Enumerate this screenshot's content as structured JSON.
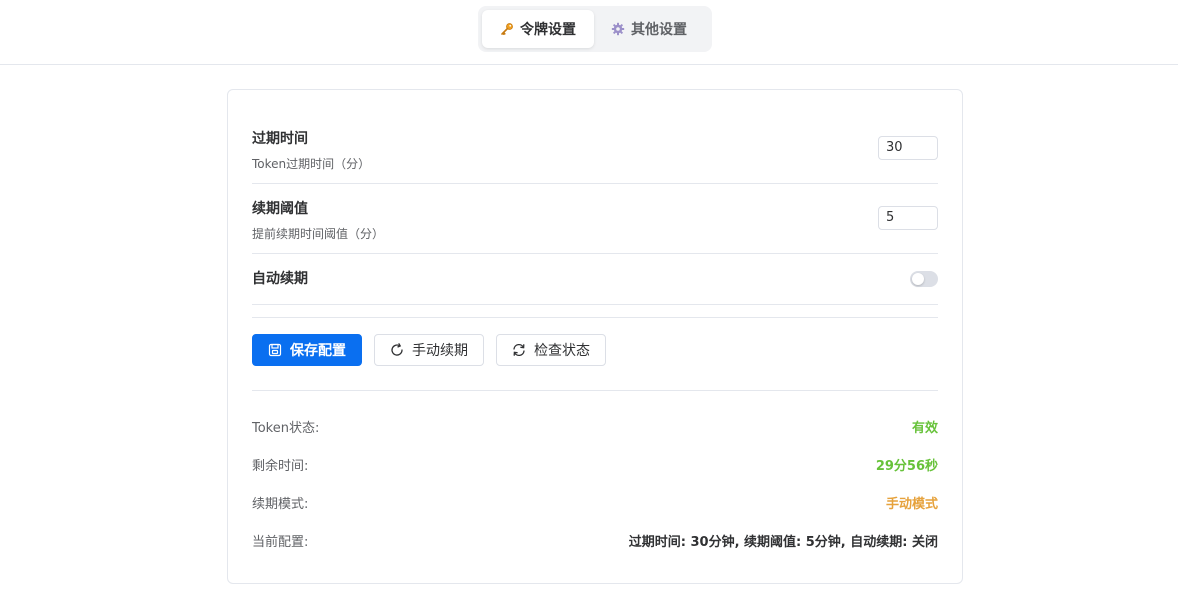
{
  "tabs": [
    {
      "label": "令牌设置",
      "icon": "key-icon",
      "active": true
    },
    {
      "label": "其他设置",
      "icon": "gear-icon",
      "active": false
    }
  ],
  "settings": {
    "expire": {
      "label": "过期时间",
      "desc": "Token过期时间（分）",
      "value": "30"
    },
    "threshold": {
      "label": "续期阈值",
      "desc": "提前续期时间阈值（分）",
      "value": "5"
    },
    "auto_renew": {
      "label": "自动续期",
      "enabled": false
    }
  },
  "buttons": {
    "save": {
      "label": "保存配置",
      "icon": "save-icon"
    },
    "renew": {
      "label": "手动续期",
      "icon": "refresh-icon"
    },
    "check": {
      "label": "检查状态",
      "icon": "sync-icon"
    }
  },
  "status": [
    {
      "label": "Token状态:",
      "value": "有效",
      "color": "#67c23a"
    },
    {
      "label": "剩余时间:",
      "value": "29分56秒",
      "color": "#67c23a"
    },
    {
      "label": "续期模式:",
      "value": "手动模式",
      "color": "#e6a23c"
    },
    {
      "label": "当前配置:",
      "value": "过期时间: 30分钟, 续期阈值: 5分钟, 自动续期: 关闭",
      "color": "#303133"
    }
  ],
  "colors": {
    "primary": "#0a6ff0",
    "success": "#67c23a",
    "warning": "#e6a23c"
  }
}
